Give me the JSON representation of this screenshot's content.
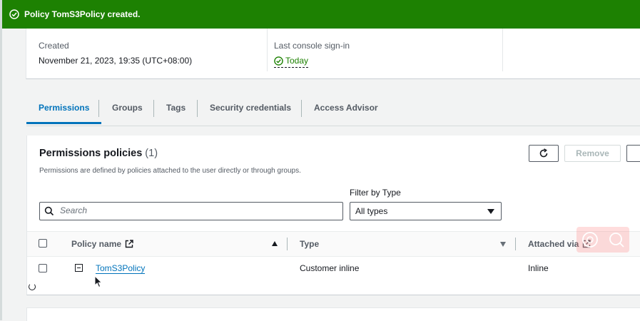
{
  "flash": {
    "message": "Policy TomS3Policy created."
  },
  "summary": {
    "created_label": "Created",
    "created_value": "November 21, 2023, 19:35 (UTC+08:00)",
    "signin_label": "Last console sign-in",
    "signin_value": "Today"
  },
  "tabs": [
    "Permissions",
    "Groups",
    "Tags",
    "Security credentials",
    "Access Advisor"
  ],
  "permissions": {
    "title": "Permissions policies",
    "count": "(1)",
    "description": "Permissions are defined by policies attached to the user directly or through groups.",
    "remove_label": "Remove",
    "filter_label": "Filter by Type",
    "search_placeholder": "Search",
    "filter_value": "All types",
    "columns": {
      "policy_name": "Policy name",
      "type": "Type",
      "attached_via": "Attached via"
    },
    "rows": [
      {
        "policy_name": "TomS3Policy",
        "type": "Customer inline",
        "attached_via": "Inline"
      }
    ]
  },
  "colors": {
    "success": "#1d8102",
    "link": "#0073bb",
    "text": "#16191f",
    "muted": "#545b64"
  }
}
